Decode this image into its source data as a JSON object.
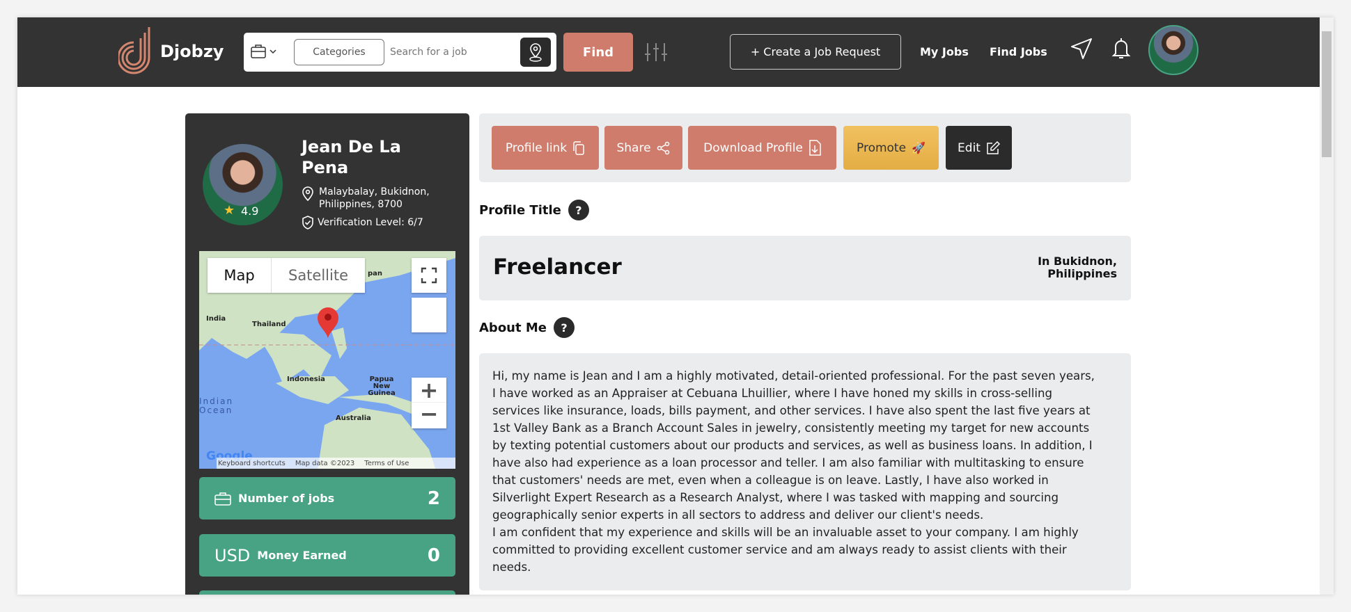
{
  "header": {
    "brand": "Djobzy",
    "categories_label": "Categories",
    "search_placeholder": "Search for a job",
    "find_label": "Find",
    "create_label": "+ Create a Job Request",
    "nav": [
      "My Jobs",
      "Find Jobs"
    ]
  },
  "profile": {
    "name": "Jean De La Pena",
    "rating": "4.9",
    "location": "Malaybalay, Bukidnon, Philippines, 8700",
    "verification": "Verification Level: 6/7"
  },
  "map": {
    "tabs": [
      "Map",
      "Satellite"
    ],
    "labels": [
      "India",
      "Thailand",
      "Indonesia",
      "Papua New Guinea",
      "Australia",
      "Indian Ocean",
      "pan"
    ],
    "footer": [
      "Keyboard shortcuts",
      "Map data ©2023",
      "Terms of Use"
    ],
    "google": "Google"
  },
  "stats": [
    {
      "label": "Number of jobs",
      "value": "2"
    },
    {
      "prefix": "USD",
      "label": "Money Earned",
      "value": "0"
    }
  ],
  "actions": [
    {
      "label": "Profile link"
    },
    {
      "label": "Share"
    },
    {
      "label": "Download Profile"
    },
    {
      "label": "Promote"
    },
    {
      "label": "Edit"
    }
  ],
  "colors": {
    "header": "#333333",
    "accent": "#cf7c6c",
    "promote": "#eab84e",
    "stat": "#48a384",
    "panel": "#ebecee"
  },
  "profile_title": {
    "heading": "Profile Title",
    "title": "Freelancer",
    "location": "In Bukidnon, Philippines"
  },
  "about": {
    "heading": "About Me",
    "lines": [
      "Hi, my name is Jean and I am a highly motivated, detail-oriented professional. For the past seven years,",
      "I have worked as an Appraiser at Cebuana Lhuillier, where I have honed my skills in cross-selling",
      "services like insurance, loads, bills payment, and other services. I have also spent the last five years at",
      "1st Valley Bank as a Branch Account Sales in jewelry, consistently meeting my target for new accounts",
      "by texting potential customers about our products and services, as well as business loans. In addition, I",
      "have also had experience as a loan processor and teller. I am also familiar with multitasking to ensure",
      "that customers' needs are met, even when a colleague is on leave. Lastly, I have also worked in",
      "Silverlight Expert Research as a Research Analyst, where I was tasked with mapping and sourcing",
      "geographically senior experts in all sectors to address and deliver our client's needs.",
      "I am confident that my experience and skills will be an invaluable asset to your company. I am highly",
      "committed to providing excellent customer service and am always ready to assist clients with their",
      "needs."
    ]
  }
}
